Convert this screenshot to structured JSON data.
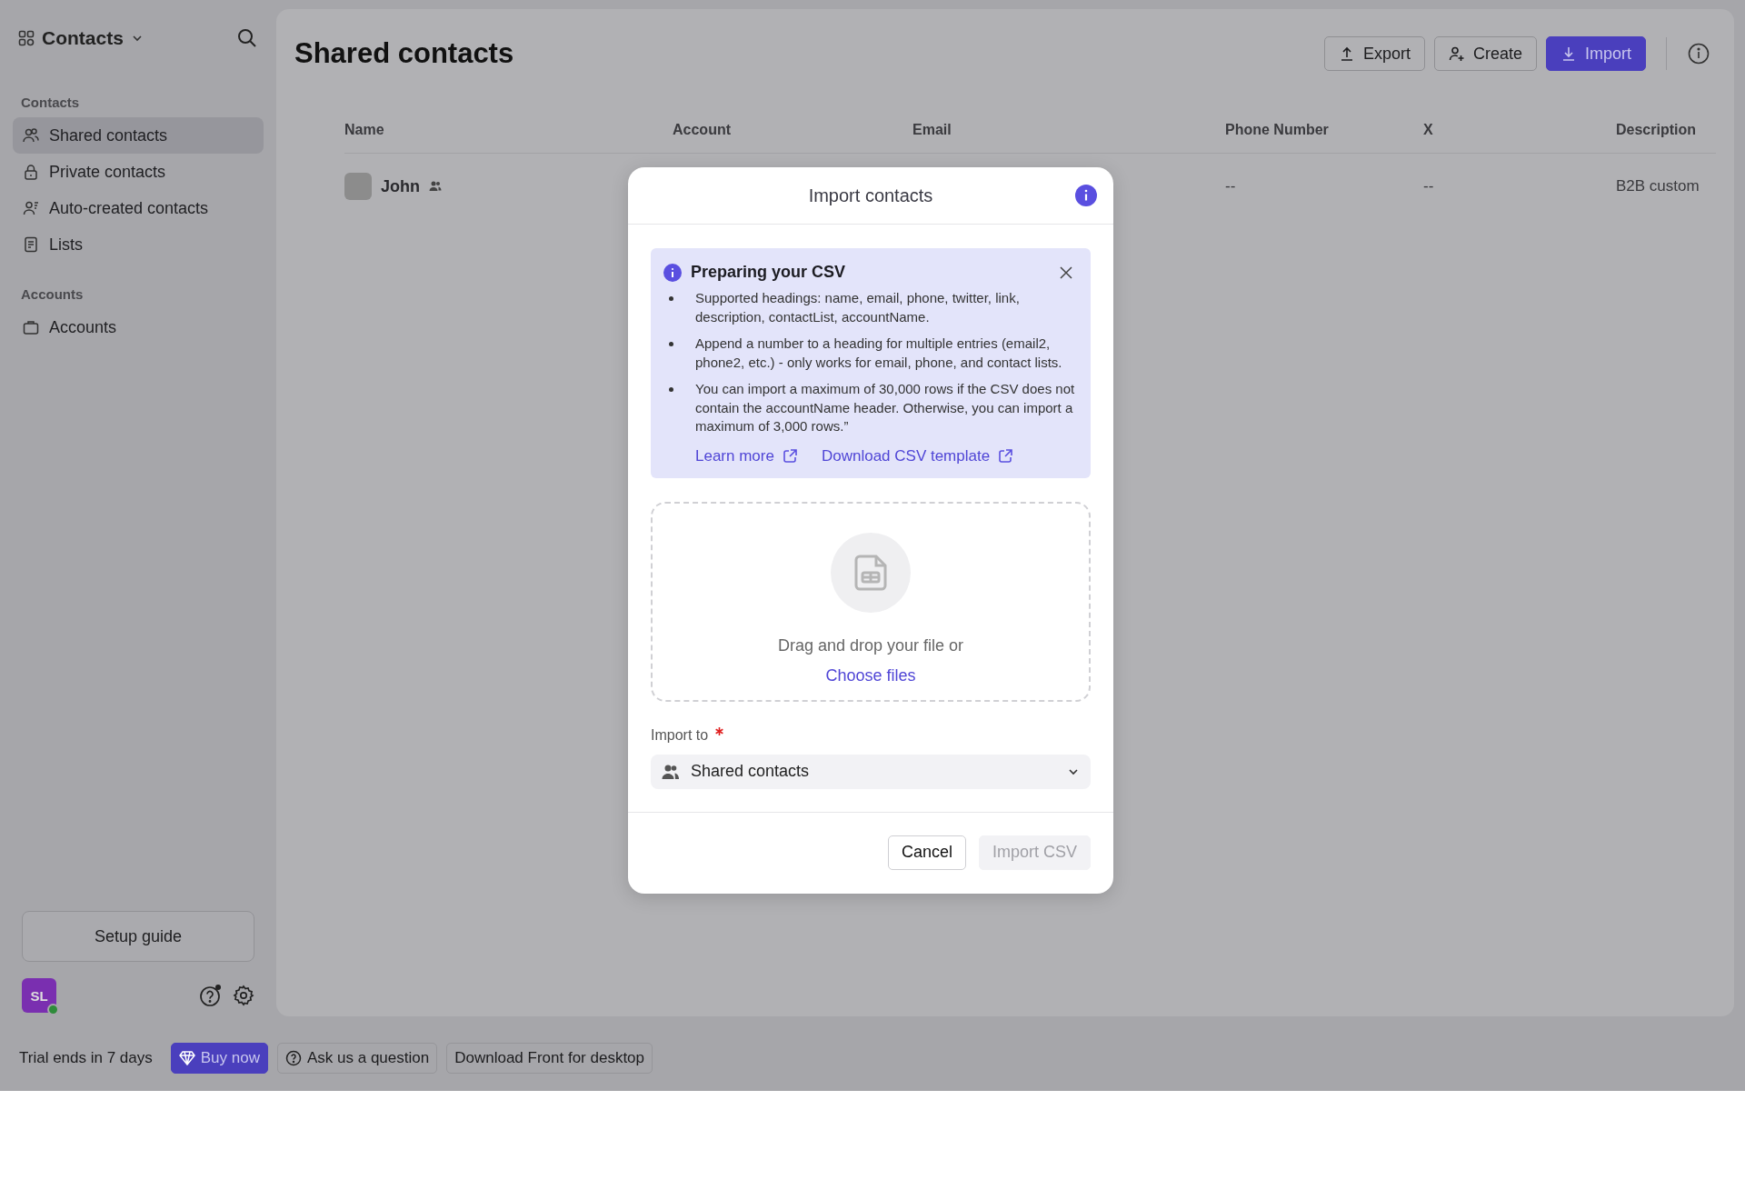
{
  "sidebar": {
    "title": "Contacts",
    "sections": [
      {
        "heading": "Contacts",
        "items": [
          {
            "label": "Shared contacts",
            "kind": "people",
            "selected": true
          },
          {
            "label": "Private contacts",
            "kind": "lock",
            "selected": false
          },
          {
            "label": "Auto-created contacts",
            "kind": "auto",
            "selected": false
          },
          {
            "label": "Lists",
            "kind": "list",
            "selected": false
          }
        ]
      },
      {
        "heading": "Accounts",
        "items": [
          {
            "label": "Accounts",
            "kind": "briefcase",
            "selected": false
          }
        ]
      }
    ],
    "setup_button": "Setup guide",
    "avatar": {
      "initials": "SL",
      "online": true
    }
  },
  "page": {
    "title": "Shared contacts",
    "buttons": [
      {
        "label": "Export",
        "kind": "export"
      },
      {
        "label": "Create",
        "kind": "create"
      },
      {
        "label": "Import",
        "kind": "import"
      }
    ]
  },
  "table": {
    "columns": [
      "Name",
      "Account",
      "Email",
      "Phone Number",
      "X",
      "Description"
    ],
    "rows": [
      {
        "name": "John",
        "account": "",
        "email": "",
        "phone": "--",
        "x": "--",
        "description": "B2B custom"
      }
    ]
  },
  "modal": {
    "title": "Import contacts",
    "notice": {
      "title": "Preparing your CSV",
      "bullets": [
        "Supported headings: name, email, phone, twitter, link, description, contactList, accountName.",
        "Append a number to a heading for multiple entries (email2, phone2, etc.) - only works for email, phone, and contact lists.",
        "You can import a maximum of 30,000 rows if the CSV does not contain the accountName header. Otherwise, you can import a maximum of 3,000 rows.”"
      ],
      "links": [
        "Learn more",
        "Download CSV template"
      ]
    },
    "dropzone": {
      "text": "Drag and drop your file or",
      "link": "Choose files"
    },
    "import_to": {
      "label": "Import to",
      "required": true,
      "value": "Shared contacts"
    },
    "buttons": [
      {
        "label": "Cancel",
        "disabled": false
      },
      {
        "label": "Import CSV",
        "disabled": true
      }
    ]
  },
  "bottom_bar": {
    "trial": "Trial ends in 7 days",
    "buttons": [
      {
        "label": "Buy now",
        "kind": "buy"
      },
      {
        "label": "Ask us a question",
        "kind": "ask"
      },
      {
        "label": "Download Front for desktop",
        "kind": "plain"
      }
    ]
  }
}
